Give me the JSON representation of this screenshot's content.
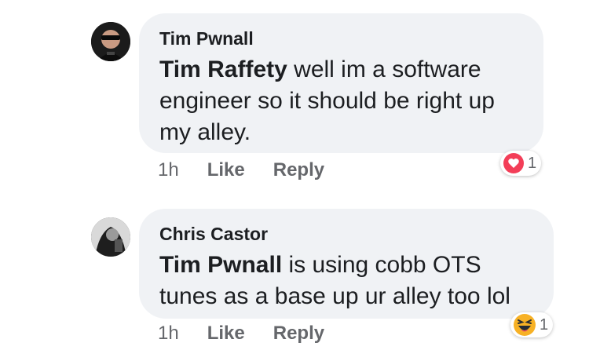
{
  "comments": [
    {
      "author": "Tim Pwnall",
      "mention": "Tim Raffety",
      "text": " well im a software engineer so it should be right up my alley.",
      "time": "1h",
      "like_label": "Like",
      "reply_label": "Reply",
      "reaction": {
        "icon": "heart-icon",
        "count": "1",
        "color": "#f33e58"
      }
    },
    {
      "author": "Chris Castor",
      "mention": "Tim Pwnall",
      "text": " is using cobb OTS tunes as a base up ur alley too lol",
      "time": "1h",
      "like_label": "Like",
      "reply_label": "Reply",
      "reaction": {
        "icon": "haha-emoji-icon",
        "count": "1",
        "color": "#f7b125"
      }
    }
  ]
}
